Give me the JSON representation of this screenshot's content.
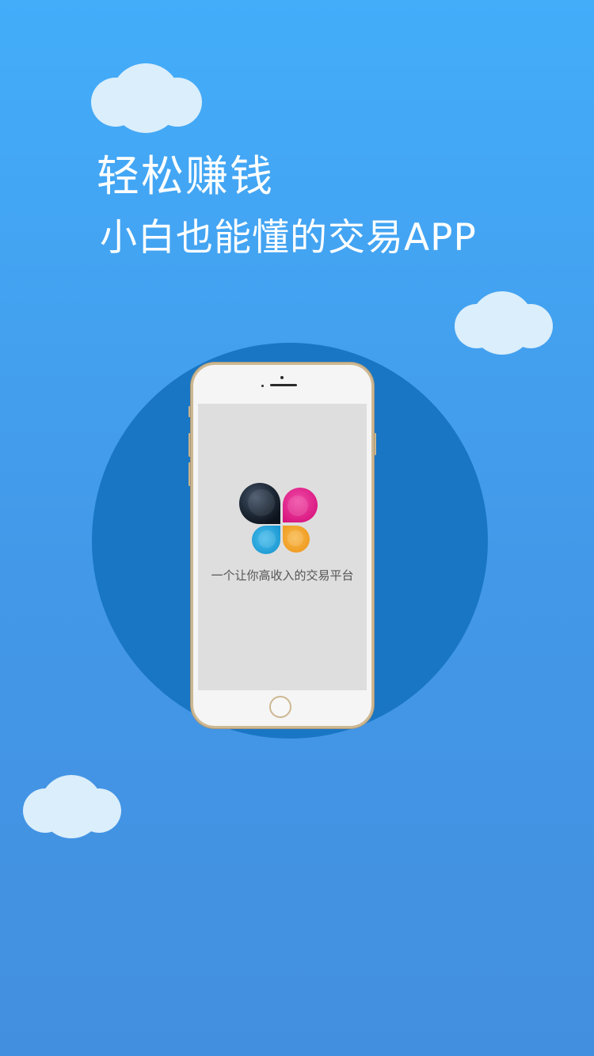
{
  "headline": {
    "line1": "轻松赚钱",
    "line2": "小白也能懂的交易APP"
  },
  "phone_screen": {
    "tagline": "一个让你高收入的交易平台"
  },
  "icons": {
    "clouds": "cloud-icon",
    "logo": "four-petal-logo-icon",
    "home": "home-button-icon"
  },
  "colors": {
    "background_top": "#43adfa",
    "background_bottom": "#438fdf",
    "circle": "#1976c5",
    "cloud": "#daeefb",
    "phone_frame": "#cdb892",
    "logo_dark": "#1b2330",
    "logo_magenta": "#e41a8a",
    "logo_cyan": "#1aa3dc",
    "logo_orange": "#f4a126"
  }
}
